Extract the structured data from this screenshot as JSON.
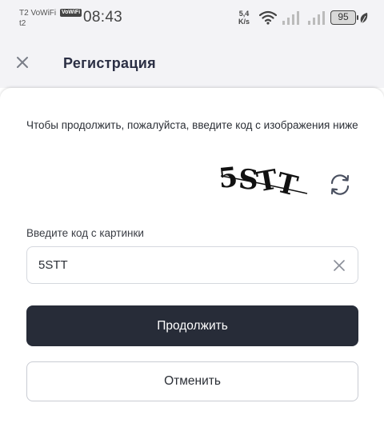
{
  "status_bar": {
    "carrier_line1": "T2 VoWiFi",
    "carrier_line2": "t2",
    "vowifi_badge": "VoWiFi",
    "time": "08:43",
    "net_speed_value": "5,4",
    "net_speed_unit": "K/s",
    "battery_level": "95",
    "icons": [
      "wifi-icon",
      "signal-icon",
      "signal-icon",
      "battery-icon",
      "leaf-icon"
    ]
  },
  "header": {
    "title": "Регистрация",
    "close_icon": "close-icon"
  },
  "captcha": {
    "instruction": "Чтобы продолжить, пожалуйста, введите код с изображения ниже",
    "image_text": "5STT",
    "refresh_icon": "refresh-icon",
    "input_label": "Введите код с картинки",
    "input_value": "5STT",
    "clear_icon": "clear-icon"
  },
  "actions": {
    "continue_label": "Продолжить",
    "cancel_label": "Отменить"
  },
  "colors": {
    "primary_button": "#272c38",
    "header_bg": "#f3f3f6",
    "border": "#d5d8de"
  }
}
